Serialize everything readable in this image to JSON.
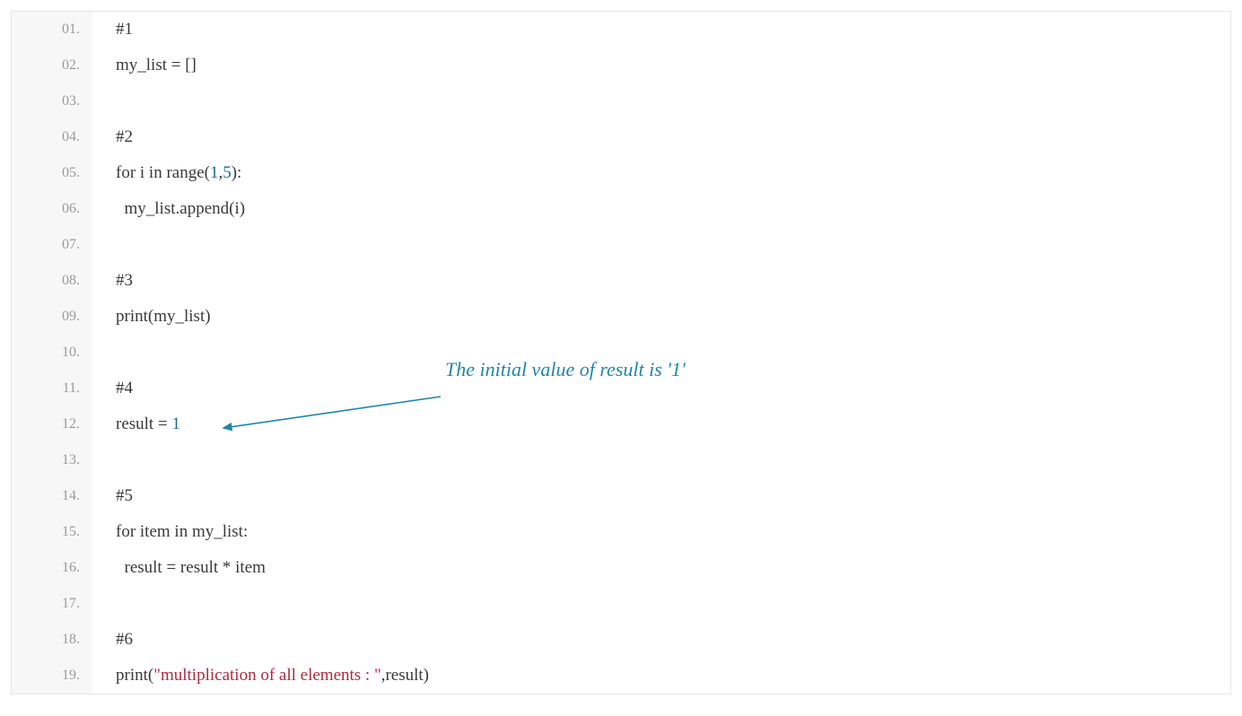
{
  "annotation": {
    "text": "The initial value of result is '1'"
  },
  "lines": [
    {
      "n": "01.",
      "segs": [
        {
          "t": "#1",
          "c": "tok-punct"
        }
      ]
    },
    {
      "n": "02.",
      "segs": [
        {
          "t": "my_list = []",
          "c": ""
        }
      ]
    },
    {
      "n": "03.",
      "segs": []
    },
    {
      "n": "04.",
      "segs": [
        {
          "t": "#2",
          "c": "tok-punct"
        }
      ]
    },
    {
      "n": "05.",
      "segs": [
        {
          "t": "for i in range(",
          "c": ""
        },
        {
          "t": "1",
          "c": "tok-num"
        },
        {
          "t": ",",
          "c": ""
        },
        {
          "t": "5",
          "c": "tok-num"
        },
        {
          "t": "):",
          "c": ""
        }
      ]
    },
    {
      "n": "06.",
      "segs": [
        {
          "t": "  my_list.append(i)",
          "c": ""
        }
      ]
    },
    {
      "n": "07.",
      "segs": []
    },
    {
      "n": "08.",
      "segs": [
        {
          "t": "#3",
          "c": "tok-punct"
        }
      ]
    },
    {
      "n": "09.",
      "segs": [
        {
          "t": "print(my_list)",
          "c": ""
        }
      ]
    },
    {
      "n": "10.",
      "segs": []
    },
    {
      "n": "11.",
      "segs": [
        {
          "t": "#4",
          "c": "tok-punct"
        }
      ]
    },
    {
      "n": "12.",
      "segs": [
        {
          "t": "result = ",
          "c": ""
        },
        {
          "t": "1",
          "c": "tok-num"
        }
      ]
    },
    {
      "n": "13.",
      "segs": []
    },
    {
      "n": "14.",
      "segs": [
        {
          "t": "#5",
          "c": "tok-punct"
        }
      ]
    },
    {
      "n": "15.",
      "segs": [
        {
          "t": "for item in my_list:",
          "c": ""
        }
      ]
    },
    {
      "n": "16.",
      "segs": [
        {
          "t": "  result = result * item",
          "c": ""
        }
      ]
    },
    {
      "n": "17.",
      "segs": []
    },
    {
      "n": "18.",
      "segs": [
        {
          "t": "#6",
          "c": "tok-punct"
        }
      ]
    },
    {
      "n": "19.",
      "segs": [
        {
          "t": "print(",
          "c": ""
        },
        {
          "t": "\"multiplication of all elements : \"",
          "c": "tok-str"
        },
        {
          "t": ",result)",
          "c": ""
        }
      ]
    }
  ],
  "colors": {
    "gutter_bg": "#f7f7f7",
    "gutter_text": "#9a9a9a",
    "code_text": "#3a3a3a",
    "number": "#1a6a8e",
    "string": "#b02940",
    "annotation": "#1f86a8",
    "border": "#e5e5e5"
  }
}
